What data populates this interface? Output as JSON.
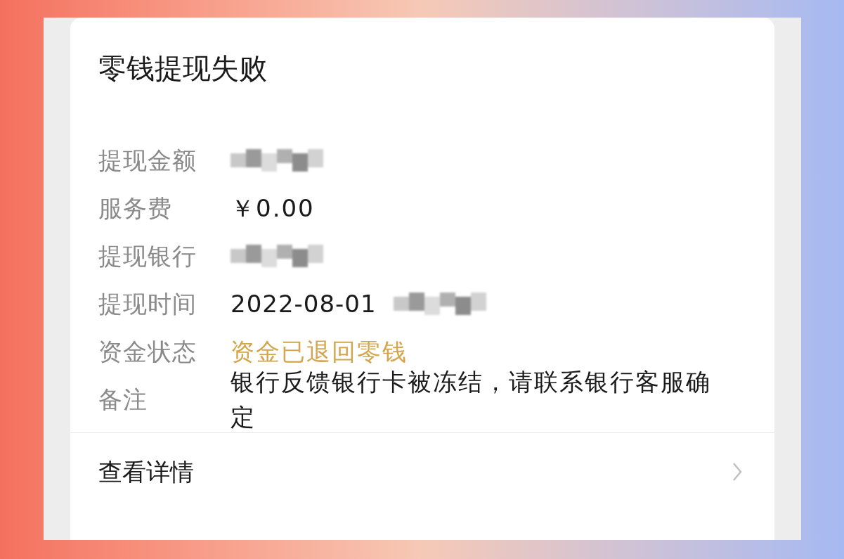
{
  "title": "零钱提现失败",
  "details": [
    {
      "label": "提现金额",
      "kind": "redacted"
    },
    {
      "label": "服务费",
      "kind": "text",
      "value": "￥0.00"
    },
    {
      "label": "提现银行",
      "kind": "redacted"
    },
    {
      "label": "提现时间",
      "kind": "text_redacted",
      "value": "2022-08-01"
    },
    {
      "label": "资金状态",
      "kind": "status",
      "value": "资金已退回零钱"
    },
    {
      "label": "备注",
      "kind": "text",
      "value": "银行反馈银行卡被冻结，请联系银行客服确定"
    }
  ],
  "link": {
    "label": "查看详情"
  }
}
